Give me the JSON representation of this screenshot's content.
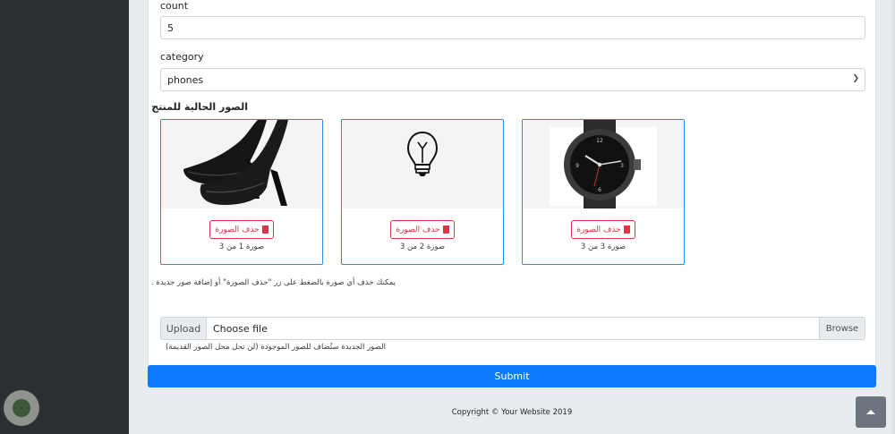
{
  "form": {
    "count_label": "count",
    "count_value": "5",
    "category_label": "category",
    "category_value": "phones",
    "current_images_heading": "الصور الحالية للمنتج",
    "images": [
      {
        "delete_label": "حذف الصورة",
        "caption": "صورة 1 من 3",
        "subject": "black high heels"
      },
      {
        "delete_label": "حذف الصورة",
        "caption": "صورة 2 من 3",
        "subject": "light bulb sketch"
      },
      {
        "delete_label": "حذف الصورة",
        "caption": "صورة 3 من 3",
        "subject": "black wrist watch"
      }
    ],
    "hint": "يمكنك حذف أي صورة بالضغط على زر \"حذف الصورة\" أو إضافة صور جديدة .",
    "upload_label": "Upload",
    "file_placeholder": "Choose file",
    "browse_label": "Browse",
    "new_images_note": "الصور الجديدة ستُضاف للصور الموجودة (لن تحل محل الصور القديمة)",
    "submit_label": "Submit"
  },
  "footer": {
    "copyright": "Copyright © Your Website 2019"
  },
  "colors": {
    "sidebar": "#2b3035",
    "primary": "#0d7bff",
    "danger": "#dc3545",
    "image_border": "#2b8be9"
  }
}
